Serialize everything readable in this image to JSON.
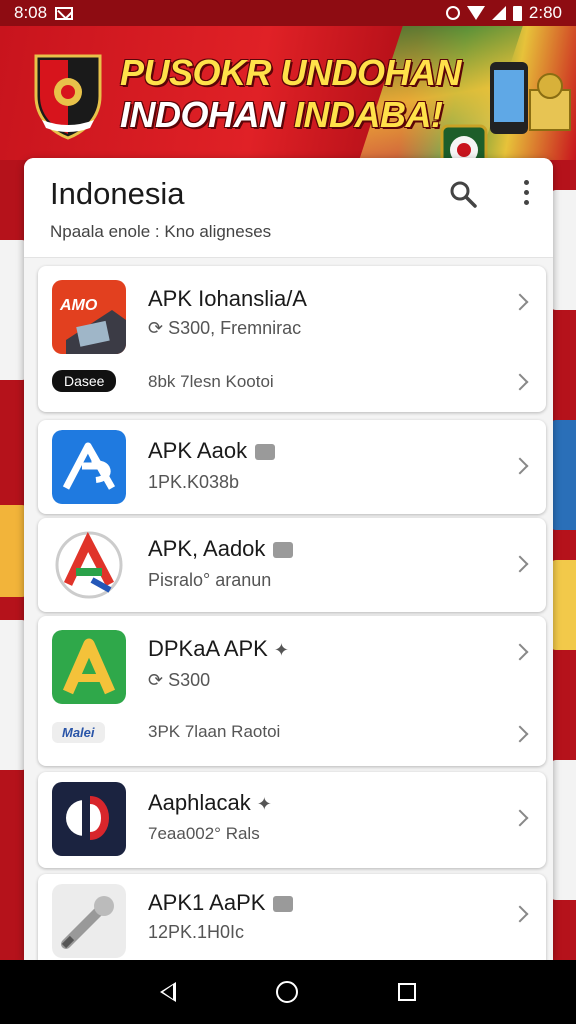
{
  "status_bar": {
    "time_left": "8:08",
    "time_right": "2:80"
  },
  "banner": {
    "line1": "PUSOKR UNDOHAN",
    "line2_white": "INDOHAN ",
    "line2_yellow": "INDABA!"
  },
  "header": {
    "title": "Indonesia",
    "subtitle": "Npaala enole : Kno aligneses"
  },
  "apps": [
    {
      "name": "APK Iohanslia/A",
      "meta": "S300, Fremnirac",
      "badge": "Dasee",
      "meta2": "8bk 7lesn Kootoi"
    },
    {
      "name": "APK Aaok",
      "meta": "1PK.K038b"
    },
    {
      "name": "APK, Aadok",
      "meta": "Pisralo° aranun"
    },
    {
      "name": "DPKaA APK",
      "meta": "S300",
      "badge": "Malei",
      "meta2": "3PK 7laan Raotoi"
    },
    {
      "name": "Aaphlacak",
      "meta": "7eaa002° Rals"
    },
    {
      "name": "APK1 AaPK",
      "meta": "12PK.1H0Ic"
    }
  ],
  "colors": {
    "brand_red": "#b5121b",
    "accent_yellow": "#ffe14a",
    "card_bg": "#ffffff"
  }
}
